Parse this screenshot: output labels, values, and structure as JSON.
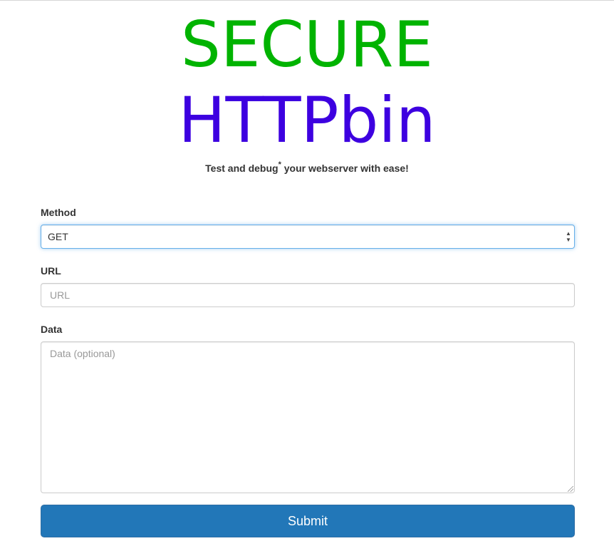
{
  "header": {
    "title_line1": "SECURE",
    "title_line2": "HTTPbin",
    "title_line1_color": "#00b300",
    "title_line2_color": "#3d00e0",
    "tagline_before": "Test and debug",
    "tagline_mark": "*",
    "tagline_after": " your webserver with ease!"
  },
  "form": {
    "method": {
      "label": "Method",
      "selected": "GET",
      "arrow_up": "▲",
      "arrow_down": "▼"
    },
    "url": {
      "label": "URL",
      "value": "",
      "placeholder": "URL"
    },
    "data": {
      "label": "Data",
      "value": "",
      "placeholder": "Data (optional)"
    },
    "submit_label": "Submit"
  },
  "colors": {
    "primary_button": "#2277b8",
    "focus_border": "#66afe9"
  }
}
